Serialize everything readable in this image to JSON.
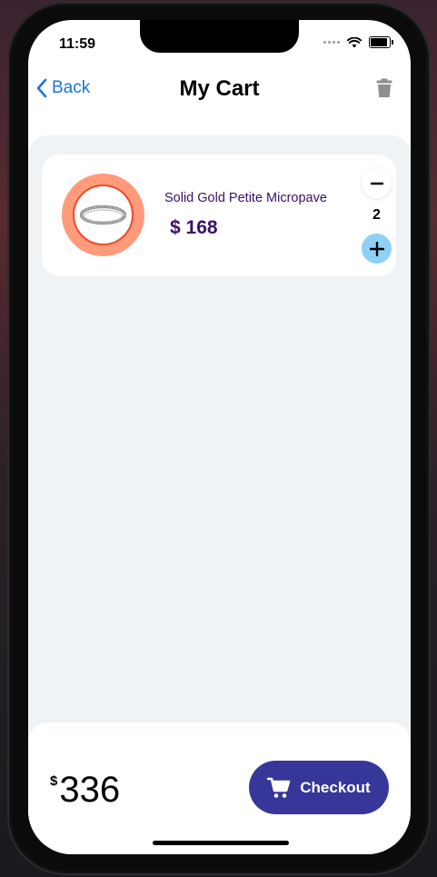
{
  "status_bar": {
    "time": "11:59"
  },
  "nav": {
    "back_label": "Back",
    "title": "My Cart"
  },
  "cart": {
    "items": [
      {
        "name": "Solid Gold Petite Micropave",
        "price": "$ 168",
        "quantity": "2"
      }
    ]
  },
  "summary": {
    "currency": "$",
    "total": "336"
  },
  "checkout": {
    "label": "Checkout"
  },
  "colors": {
    "accent_blue": "#1e73d6",
    "product_text": "#3a0f6b",
    "checkout_bg": "#37379a",
    "plus_button": "#8fd0f5",
    "product_ring": "#ff9a7a"
  },
  "icons": {
    "back": "chevron-left-icon",
    "trash": "trash-icon",
    "minus": "minus-icon",
    "plus": "plus-icon",
    "cart": "cart-icon"
  }
}
